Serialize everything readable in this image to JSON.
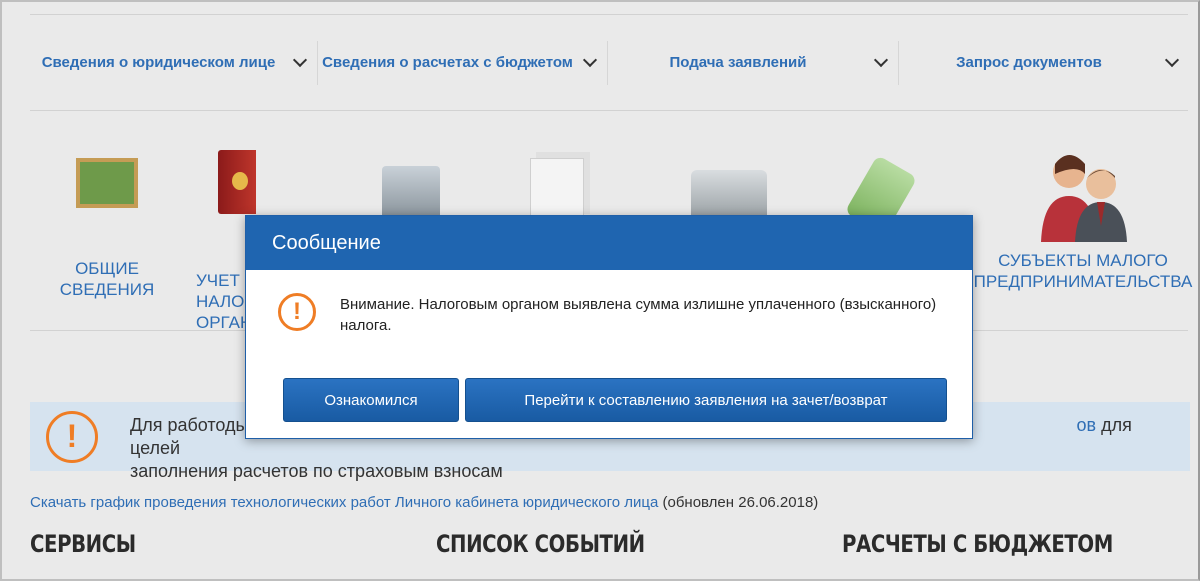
{
  "nav": [
    {
      "label": "Сведения о юридическом лице"
    },
    {
      "label": "Сведения о расчетах с бюджетом"
    },
    {
      "label": "Подача заявлений"
    },
    {
      "label": "Запрос документов"
    }
  ],
  "categories": [
    {
      "label": "Общие сведения",
      "icon": "teacher-board-icon"
    },
    {
      "label": "Учет в налоговых органах",
      "icon": "registry-book-icon"
    },
    {
      "label": "",
      "icon": "calculator-icon"
    },
    {
      "label": "",
      "icon": "documents-icon"
    },
    {
      "label": "",
      "icon": "cash-register-icon"
    },
    {
      "label": "",
      "icon": "price-tag-icon"
    },
    {
      "label": "Субъекты малого предпринимательства",
      "icon": "business-people-icon"
    }
  ],
  "notice": {
    "text_before": "Для работоды",
    "link_fragment": "ов",
    "text_after": " для целей",
    "line2": "заполнения расчетов по страховым взносам"
  },
  "download": {
    "link": "Скачать график проведения технологических работ Личного кабинета юридического лица",
    "note": " (обновлен 26.06.2018)"
  },
  "sections": [
    "СЕРВИСЫ",
    "СПИСОК СОБЫТИЙ",
    "РАСЧЕТЫ С БЮДЖЕТОМ"
  ],
  "modal": {
    "title": "Сообщение",
    "message": "Внимание. Налоговым органом выявлена сумма излишне уплаченного (взысканного) налога.",
    "btn_ack": "Ознакомился",
    "btn_go": "Перейти к составлению заявления на зачет/возврат"
  },
  "colors": {
    "accent": "#1f65b0",
    "link": "#2f6eb5",
    "warn": "#ef7d25"
  }
}
